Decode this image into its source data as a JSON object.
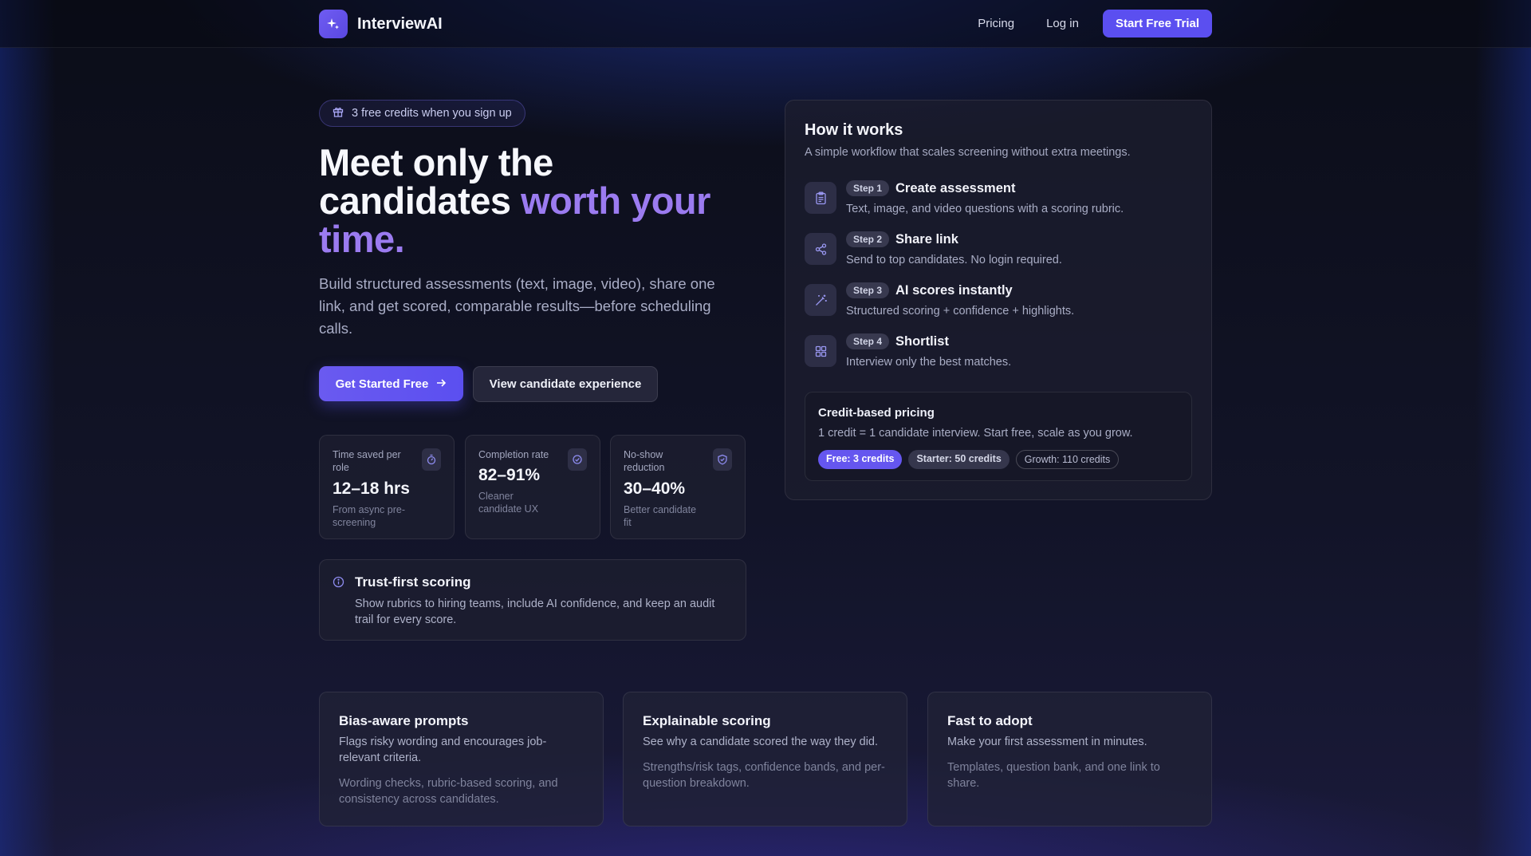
{
  "header": {
    "brand": "InterviewAI",
    "nav": {
      "pricing": "Pricing",
      "login": "Log in",
      "trial": "Start Free Trial"
    }
  },
  "hero": {
    "badge": "3 free credits when you sign up",
    "title_line1": "Meet only the",
    "title_line2_plain": "candidates",
    "title_accent": "worth your time.",
    "subtitle": "Build structured assessments (text, image, video), share one link, and get scored, comparable results—before scheduling calls.",
    "cta_primary": "Get Started Free",
    "cta_secondary": "View candidate experience"
  },
  "stats": [
    {
      "label": "Time saved per role",
      "value": "12–18 hrs",
      "note": "From async pre-screening",
      "icon": "stopwatch-icon"
    },
    {
      "label": "Completion rate",
      "value": "82–91%",
      "note": "Cleaner candidate UX",
      "icon": "check-circle-icon"
    },
    {
      "label": "No-show reduction",
      "value": "30–40%",
      "note": "Better candidate fit",
      "icon": "shield-check-icon"
    }
  ],
  "trust": {
    "title": "Trust-first scoring",
    "text": "Show rubrics to hiring teams, include AI confidence, and keep an audit trail for every score."
  },
  "how": {
    "title": "How it works",
    "subtitle": "A simple workflow that scales screening without extra meetings.",
    "steps": [
      {
        "pill": "Step 1",
        "title": "Create assessment",
        "text": "Text, image, and video questions with a scoring rubric.",
        "icon": "clipboard-icon"
      },
      {
        "pill": "Step 2",
        "title": "Share link",
        "text": "Send to top candidates. No login required.",
        "icon": "share-icon"
      },
      {
        "pill": "Step 3",
        "title": "AI scores instantly",
        "text": "Structured scoring + confidence + highlights.",
        "icon": "magic-wand-icon"
      },
      {
        "pill": "Step 4",
        "title": "Shortlist",
        "text": "Interview only the best matches.",
        "icon": "grid-icon"
      }
    ],
    "pricing": {
      "title": "Credit-based pricing",
      "text": "1 credit = 1 candidate interview. Start free, scale as you grow.",
      "tiers": [
        "Free: 3 credits",
        "Starter: 50 credits",
        "Growth: 110 credits"
      ]
    }
  },
  "features": [
    {
      "title": "Bias-aware prompts",
      "desc": "Flags risky wording and encourages job-relevant criteria.",
      "detail": "Wording checks, rubric-based scoring, and consistency across candidates."
    },
    {
      "title": "Explainable scoring",
      "desc": "See why a candidate scored the way they did.",
      "detail": "Strengths/risk tags, confidence bands, and per-question breakdown."
    },
    {
      "title": "Fast to adopt",
      "desc": "Make your first assessment in minutes.",
      "detail": "Templates, question bank, and one link to share."
    }
  ],
  "colors": {
    "accent": "#5b4ff0",
    "accent_text": "#9b7bf0",
    "background": "#0d0f1c"
  }
}
